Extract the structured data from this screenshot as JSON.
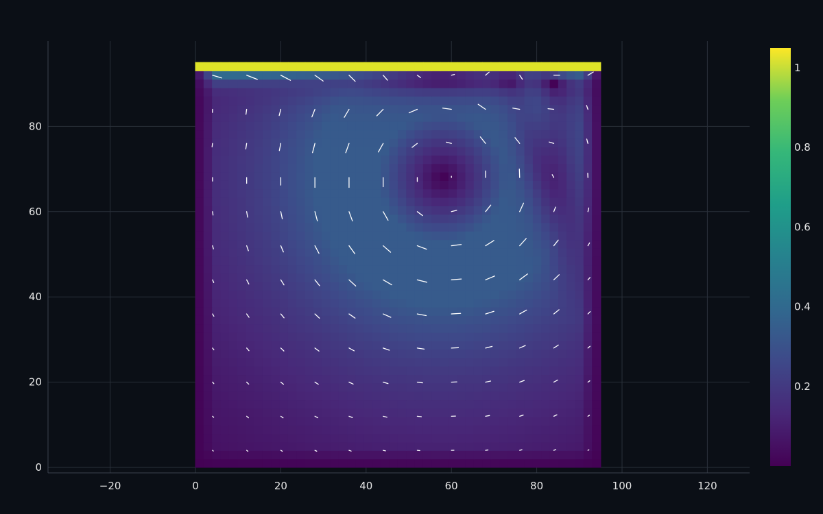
{
  "chart_data": {
    "type": "heatmap",
    "title": "",
    "xlabel": "",
    "ylabel": "",
    "xlim": [
      -35,
      130
    ],
    "ylim": [
      -1,
      99
    ],
    "x_ticks": [
      -20,
      0,
      20,
      40,
      60,
      80,
      100,
      120
    ],
    "y_ticks": [
      0,
      20,
      40,
      60,
      80
    ],
    "x_tick_labels": [
      "−20",
      "0",
      "20",
      "40",
      "60",
      "80",
      "100",
      "120"
    ],
    "y_tick_labels": [
      "0",
      "20",
      "40",
      "60",
      "80"
    ],
    "heatmap": {
      "x_range": [
        0,
        95
      ],
      "y_range": [
        0,
        95
      ],
      "description_of_values": "velocity magnitude, lid-driven cavity flow",
      "lid_value": 1.0,
      "vortex_center": [
        58,
        68
      ]
    },
    "colorbar": {
      "colorscale": "Viridis",
      "range": [
        0,
        1.05
      ],
      "ticks": [
        0.2,
        0.4,
        0.6,
        0.8,
        1.0
      ],
      "tick_labels": [
        "0.2",
        "0.4",
        "0.6",
        "0.8",
        "1"
      ]
    },
    "quiver": {
      "x": [
        4,
        12,
        20,
        28,
        36,
        44,
        52,
        60,
        68,
        76,
        84,
        92
      ],
      "y": [
        4,
        12,
        20,
        28,
        36,
        44,
        52,
        60,
        68,
        76,
        84,
        92
      ],
      "color": "#ffffff"
    },
    "grid": true,
    "colors": {
      "background": "#0b0f16",
      "grid": "#2a303a",
      "text": "#e6e6e6"
    }
  }
}
